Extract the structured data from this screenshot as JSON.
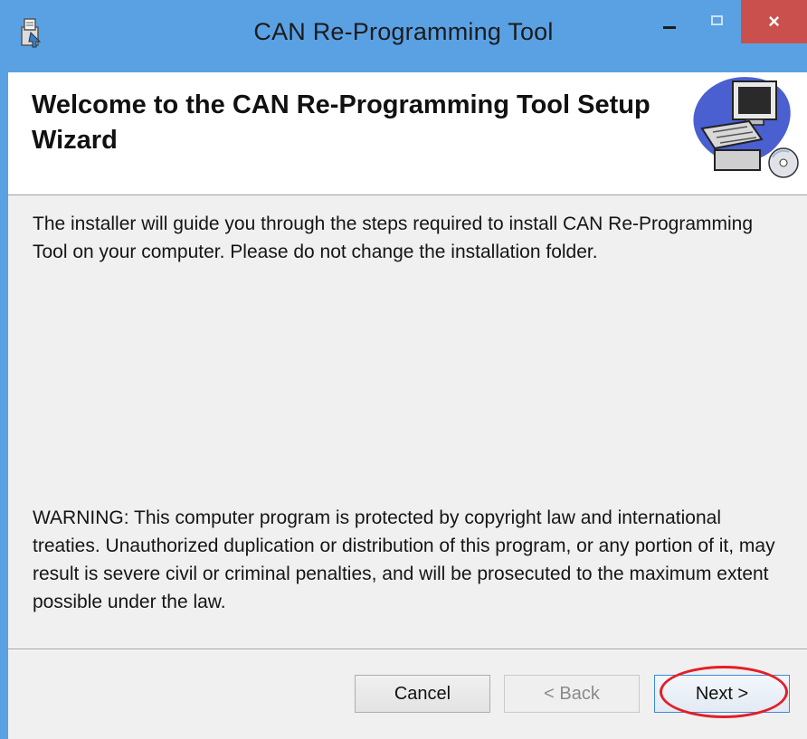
{
  "window": {
    "title": "CAN Re-Programming Tool",
    "close_glyph": "×",
    "colors": {
      "titlebar": "#5aa1e4",
      "close_button": "#c9504c",
      "client_background": "#f0f0f0",
      "highlight_ring": "#e41e26"
    }
  },
  "header": {
    "title": "Welcome to the CAN Re-Programming Tool Setup Wizard",
    "graphic_icon": "computer-setup-icon"
  },
  "body": {
    "intro": "The installer will guide you through the steps required to install CAN Re-Programming Tool on your computer. Please do not change the installation folder.",
    "warning": "WARNING: This computer program is protected by copyright law and international treaties. Unauthorized duplication or distribution of this program, or any portion of it, may result is severe civil or criminal penalties, and will be prosecuted to the maximum extent possible under the law."
  },
  "buttons": {
    "cancel": "Cancel",
    "back": "< Back",
    "next": "Next >"
  }
}
